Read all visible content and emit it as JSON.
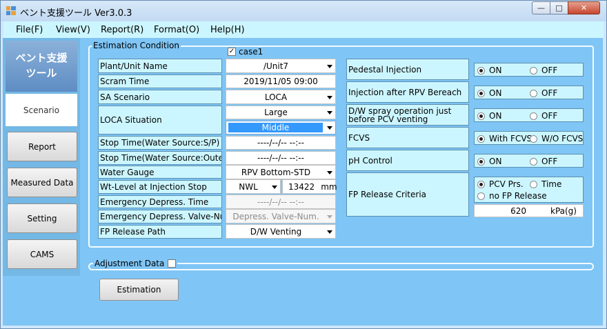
{
  "window": {
    "title": "ベント支援ツール Ver3.0.3",
    "minimize_glyph": "—",
    "maximize_glyph": "□",
    "close_glyph": "✕"
  },
  "menu": [
    "File(F)",
    "View(V)",
    "Report(R)",
    "Format(O)",
    "Help(H)"
  ],
  "sidebar": {
    "logo_line1": "ベント支援",
    "logo_line2": "ツール",
    "active_tab": "Scenario",
    "buttons": [
      "Report",
      "Measured Data",
      "Setting",
      "CAMS"
    ]
  },
  "estimation": {
    "group_title": "Estimation Condition",
    "case_label": "case1",
    "case_checked": true,
    "rows": {
      "plant": {
        "label": "Plant/Unit Name",
        "value": "/Unit7"
      },
      "scram": {
        "label": "Scram Time",
        "value": "2019/11/05 09:00"
      },
      "sa": {
        "label": "SA Scenario",
        "value": "LOCA"
      },
      "loca": {
        "label": "LOCA Situation",
        "value1": "Large",
        "value2": "Middle"
      },
      "stop_sp": {
        "label": "Stop Time(Water Source:S/P)",
        "value": "----/--/-- --:--"
      },
      "stop_outer": {
        "label": "Stop Time(Water Source:Outer)",
        "value": "----/--/-- --:--"
      },
      "gauge": {
        "label": "Water Gauge",
        "value": "RPV Bottom-STD"
      },
      "wt_level": {
        "label": "Wt-Level at Injection Stop",
        "select": "NWL",
        "value": "13422",
        "unit": "mm"
      },
      "emerg_time": {
        "label": "Emergency Depress. Time",
        "value": "----/--/-- --:--"
      },
      "emerg_valve": {
        "label": "Emergency Depress. Valve-Num.",
        "value": "Depress. Valve-Num."
      },
      "fp_path": {
        "label": "FP Release Path",
        "value": "D/W Venting"
      }
    },
    "right": {
      "pedestal": {
        "label": "Pedestal Injection",
        "opt1": "ON",
        "opt2": "OFF"
      },
      "after_rpv": {
        "label": "Injection after RPV Bereach",
        "opt1": "ON",
        "opt2": "OFF"
      },
      "dw_spray": {
        "label": "D/W spray operation just before PCV venting",
        "opt1": "ON",
        "opt2": "OFF"
      },
      "fcvs": {
        "label": "FCVS",
        "opt1": "With FCVS",
        "opt2": "W/O FCVS"
      },
      "ph": {
        "label": "pH Control",
        "opt1": "ON",
        "opt2": "OFF"
      },
      "fp_criteria": {
        "label": "FP Release Criteria",
        "opt1": "PCV Prs.",
        "opt2": "Time",
        "opt3": "no FP Release",
        "value": "620",
        "unit": "kPa(g)"
      }
    }
  },
  "adjustment": {
    "label": "Adjustment Data",
    "checked": false
  },
  "estimation_button": "Estimation"
}
